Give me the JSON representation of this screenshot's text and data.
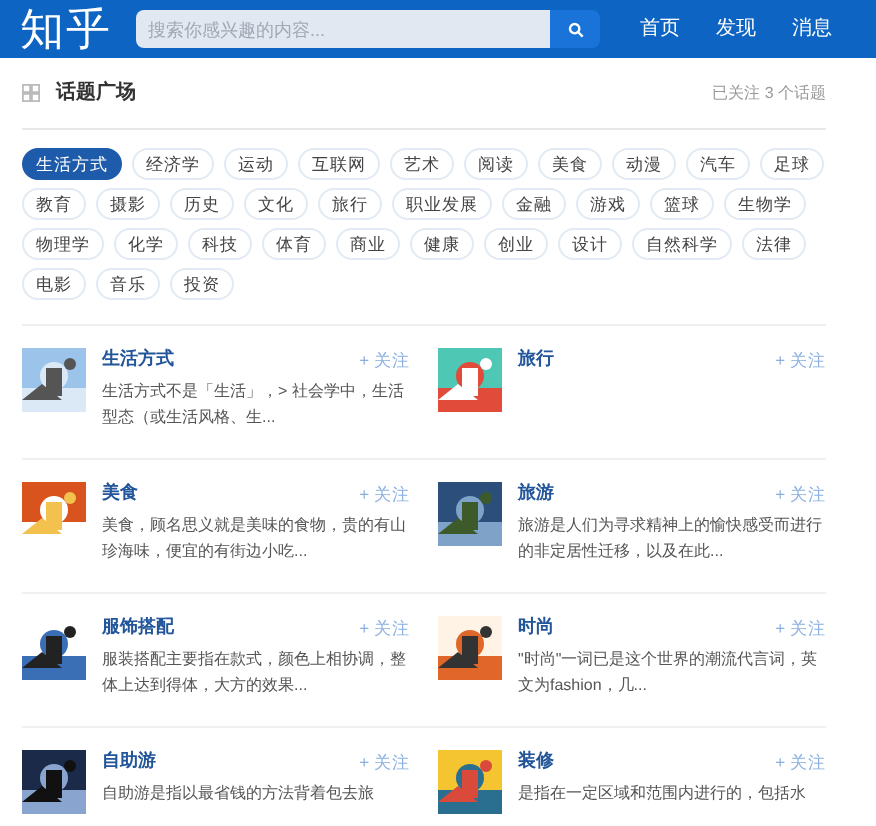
{
  "header": {
    "logo": "知乎",
    "search": {
      "placeholder": "搜索你感兴趣的内容..."
    },
    "nav": [
      {
        "label": "首页"
      },
      {
        "label": "发现"
      },
      {
        "label": "消息"
      }
    ]
  },
  "title_bar": {
    "title": "话题广场",
    "followed": "已关注 3 个话题"
  },
  "tags": [
    {
      "label": "生活方式",
      "selected": true
    },
    {
      "label": "经济学",
      "selected": false
    },
    {
      "label": "运动",
      "selected": false
    },
    {
      "label": "互联网",
      "selected": false
    },
    {
      "label": "艺术",
      "selected": false
    },
    {
      "label": "阅读",
      "selected": false
    },
    {
      "label": "美食",
      "selected": false
    },
    {
      "label": "动漫",
      "selected": false
    },
    {
      "label": "汽车",
      "selected": false
    },
    {
      "label": "足球",
      "selected": false
    },
    {
      "label": "教育",
      "selected": false
    },
    {
      "label": "摄影",
      "selected": false
    },
    {
      "label": "历史",
      "selected": false
    },
    {
      "label": "文化",
      "selected": false
    },
    {
      "label": "旅行",
      "selected": false
    },
    {
      "label": "职业发展",
      "selected": false
    },
    {
      "label": "金融",
      "selected": false
    },
    {
      "label": "游戏",
      "selected": false
    },
    {
      "label": "篮球",
      "selected": false
    },
    {
      "label": "生物学",
      "selected": false
    },
    {
      "label": "物理学",
      "selected": false
    },
    {
      "label": "化学",
      "selected": false
    },
    {
      "label": "科技",
      "selected": false
    },
    {
      "label": "体育",
      "selected": false
    },
    {
      "label": "商业",
      "selected": false
    },
    {
      "label": "健康",
      "selected": false
    },
    {
      "label": "创业",
      "selected": false
    },
    {
      "label": "设计",
      "selected": false
    },
    {
      "label": "自然科学",
      "selected": false
    },
    {
      "label": "法律",
      "selected": false
    },
    {
      "label": "电影",
      "selected": false
    },
    {
      "label": "音乐",
      "selected": false
    },
    {
      "label": "投资",
      "selected": false
    }
  ],
  "topics": [
    {
      "name": "生活方式",
      "follow": "+ 关注",
      "description": "生活方式不是「生活」，> 社会学中，生活型态（或生活风格、生..."
    },
    {
      "name": "旅行",
      "follow": "+ 关注"
    },
    {
      "name": "美食",
      "follow": "+ 关注",
      "description": "美食，顾名思义就是美味的食物，贵的有山珍海味，便宜的有街边小吃..."
    },
    {
      "name": "旅游",
      "follow": "+ 关注",
      "description": "旅游是人们为寻求精神上的愉快感受而进行的非定居性迁移，以及在此..."
    },
    {
      "name": "服饰搭配",
      "follow": "+ 关注",
      "description": "服装搭配主要指在款式，颜色上相协调，整体上达到得体，大方的效果..."
    },
    {
      "name": "时尚",
      "follow": "+ 关注",
      "description": "\"时尚\"一词已是这个世界的潮流代言词，英文为fashion，几..."
    },
    {
      "name": "自助游",
      "follow": "+ 关注",
      "description": "自助游是指以最省钱的方法背着包去旅"
    },
    {
      "name": "装修",
      "follow": "+ 关注",
      "description": "是指在一定区域和范围内进行的，包括水"
    }
  ]
}
